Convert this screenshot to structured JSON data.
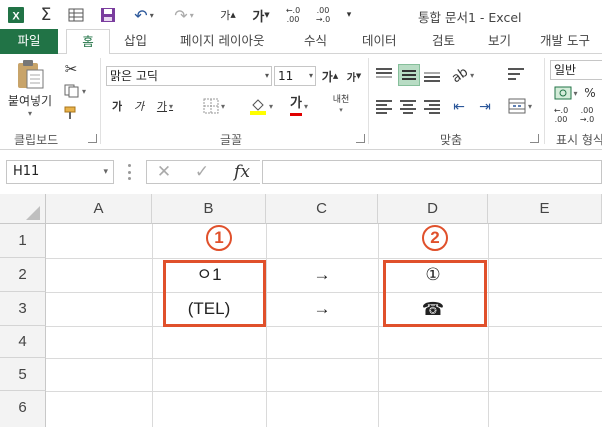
{
  "title_bar": {
    "title": "통합 문서1 - Excel",
    "quick_access": [
      "excel-logo-icon",
      "sum-icon",
      "table-icon",
      "save-icon",
      "undo-icon",
      "redo-icon",
      "font-grow-icon",
      "font-shrink-icon",
      "decimal-increase-icon",
      "decimal-decrease-icon",
      "customize-icon"
    ],
    "qa_font_grow": "가",
    "qa_font_shrink": "가"
  },
  "tabs": {
    "file": "파일",
    "home": "홈",
    "insert": "삽입",
    "page_layout": "페이지 레이아웃",
    "formulas": "수식",
    "data": "데이터",
    "review": "검토",
    "view": "보기",
    "developer": "개발 도구"
  },
  "ribbon": {
    "clipboard": {
      "paste_label": "붙여넣기",
      "group_label": "클립보드"
    },
    "font": {
      "font_name": "맑은 고딕",
      "font_size": "11",
      "grow_label": "가",
      "shrink_label": "가",
      "bold_label": "가",
      "italic_label": "가",
      "underline_label": "가",
      "font_color_label": "가",
      "phonetic_label": "내천",
      "group_label": "글꼴"
    },
    "alignment": {
      "group_label": "맞춤"
    },
    "number": {
      "format": "일반",
      "group_label": "표시 형식"
    }
  },
  "formula_bar": {
    "name_box": "H11",
    "fx_label": "fx",
    "formula": ""
  },
  "sheet": {
    "columns": [
      "A",
      "B",
      "C",
      "D",
      "E"
    ],
    "rows": [
      "1",
      "2",
      "3",
      "4",
      "5",
      "6"
    ],
    "cells": {
      "B2": "ㅇ1",
      "C2": "→",
      "D2": "①",
      "B3": "(TEL)",
      "C3": "→",
      "D3": "☎"
    },
    "annotations": {
      "marker1": "1",
      "marker2": "2",
      "color": "#e0502b"
    }
  },
  "colors": {
    "excel_green": "#217346",
    "highlight": "#e0502b"
  }
}
